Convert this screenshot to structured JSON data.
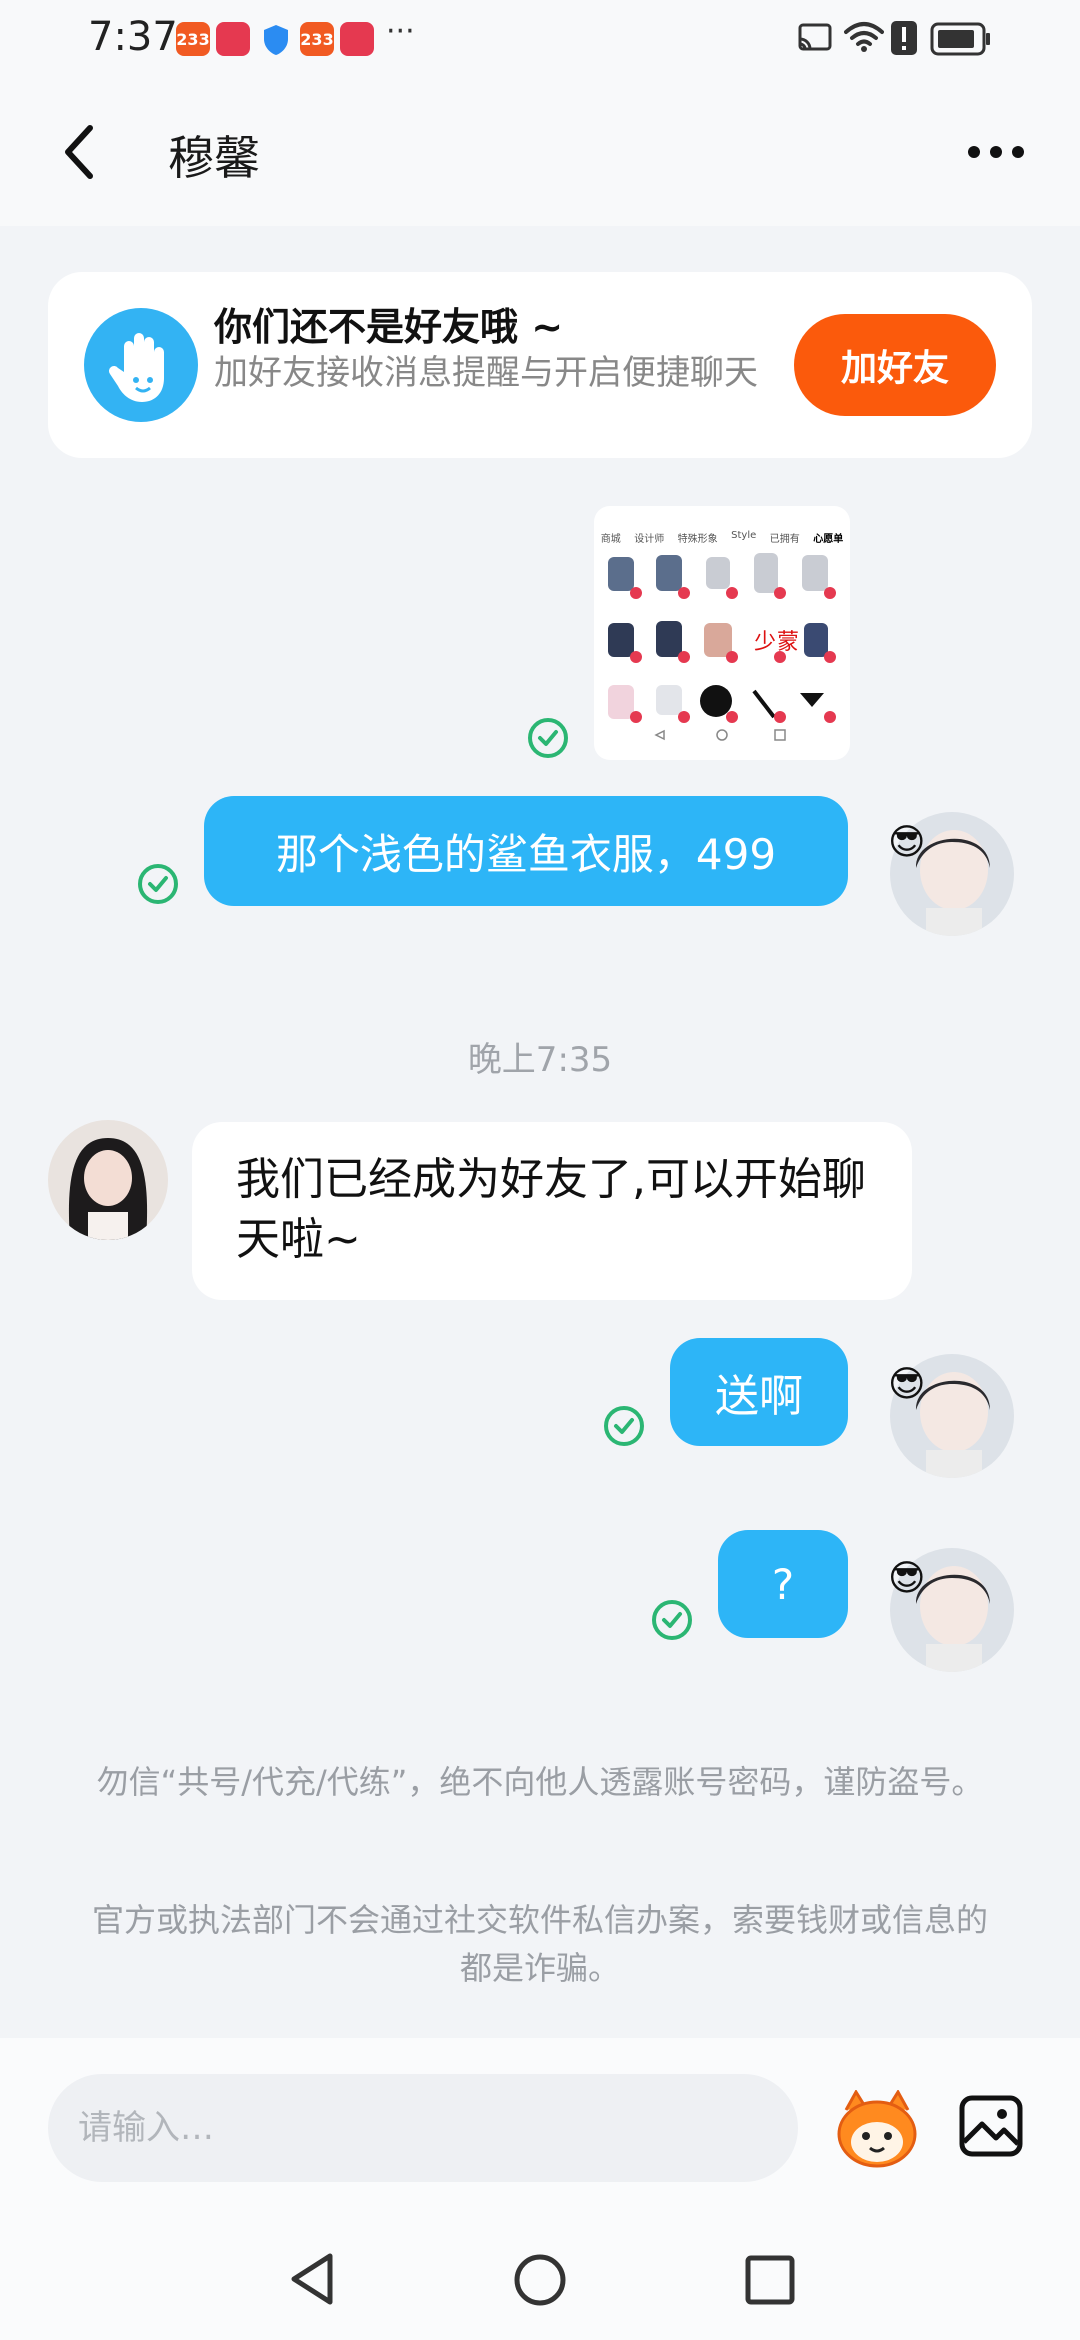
{
  "status_bar": {
    "time": "7:37",
    "app_badge": "233",
    "notification_more": "···"
  },
  "header": {
    "back_icon": "chevron-left-icon",
    "title": "穆馨",
    "more_icon": "more-dots-icon"
  },
  "friend_card": {
    "title": "你们还不是好友哦 ~",
    "subtitle": "加好友接收消息提醒与开启便捷聊天",
    "button": "加好友",
    "icon": "hand-wave-icon"
  },
  "shop_image": {
    "tabs": [
      "商城",
      "设计师",
      "特殊形象",
      "Style",
      "已拥有",
      "心愿单"
    ]
  },
  "messages": [
    {
      "id": "m1",
      "direction": "out",
      "text": "那个浅色的鲨鱼衣服，499"
    },
    {
      "id": "m2",
      "direction": "in",
      "text": "我们已经成为好友了,可以开始聊天啦~"
    },
    {
      "id": "m3",
      "direction": "out",
      "text": "送啊"
    },
    {
      "id": "m4",
      "direction": "out",
      "text": "?"
    }
  ],
  "timestamp": "晚上7:35",
  "warnings": [
    "勿信“共号/代充/代练”，绝不向他人透露账号密码，谨防盗号。",
    "官方或执法部门不会通过社交软件私信办案，索要钱财或信息的都是诈骗。"
  ],
  "input": {
    "placeholder": "请输入…"
  },
  "colors": {
    "accent_blue": "#2db5f7",
    "add_button": "#fb5a0c",
    "read_check": "#2bb673",
    "background": "#f2f4f7"
  }
}
